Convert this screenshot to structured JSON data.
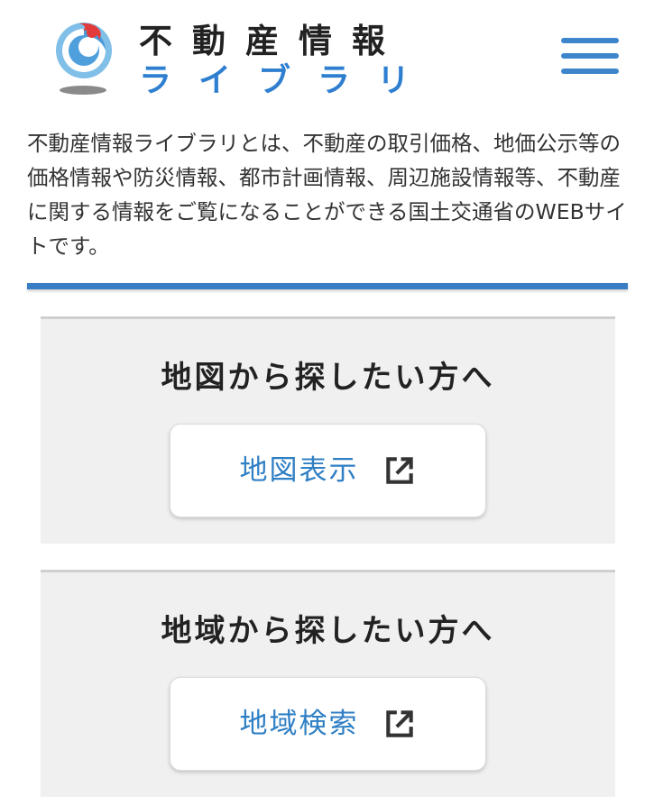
{
  "header": {
    "logo_line1": "不動産情報",
    "logo_line2": "ライブラリ",
    "logo_icon": "mlit-logo-icon",
    "menu_icon": "hamburger-menu-icon"
  },
  "intro": {
    "text": "不動産情報ライブラリとは、不動産の取引価格、地価公示等の価格情報や防災情報、都市計画情報、周辺施設情報等、不動産に関する情報をご覧になることができる国土交通省のWEBサイトです。"
  },
  "sections": [
    {
      "title": "地図から探したい方へ",
      "button_label": "地図表示",
      "button_icon": "external-link-icon"
    },
    {
      "title": "地域から探したい方へ",
      "button_label": "地域検索",
      "button_icon": "external-link-icon"
    }
  ],
  "colors": {
    "brand_blue": "#3a7dc4",
    "link_blue": "#2f7fc4",
    "text_dark": "#222222",
    "section_bg": "#f0f0f0"
  }
}
